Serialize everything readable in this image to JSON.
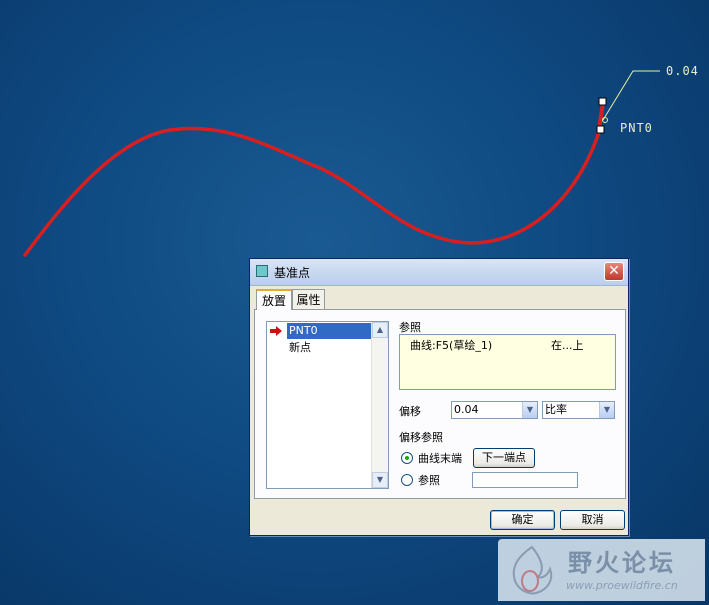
{
  "viewport": {
    "offset_callout": "0.04",
    "point_label": "PNT0",
    "curve_color": "#d81f1f"
  },
  "dialog": {
    "title": "基准点",
    "close_glyph": "✕",
    "tabs": [
      {
        "label": "放置",
        "active": true
      },
      {
        "label": "属性",
        "active": false
      }
    ],
    "points_list": {
      "items": [
        {
          "label": "PNT0",
          "selected": true
        },
        {
          "label": "新点",
          "selected": false
        }
      ]
    },
    "references": {
      "label": "参照",
      "rows": [
        {
          "entity": "曲线:F5(草绘_1)",
          "constraint": "在...上"
        }
      ]
    },
    "offset": {
      "label": "偏移",
      "value": "0.04",
      "type": "比率"
    },
    "offset_reference": {
      "label": "偏移参照",
      "options": [
        {
          "label": "曲线末端",
          "checked": true
        },
        {
          "label": "参照",
          "checked": false
        }
      ],
      "next_endpoint_button": "下一端点",
      "reference_value": ""
    },
    "footer": {
      "ok_button": "确定",
      "cancel_button": "取消"
    }
  },
  "watermark": {
    "title": "野火论坛",
    "url": "www.proewildfire.cn"
  }
}
